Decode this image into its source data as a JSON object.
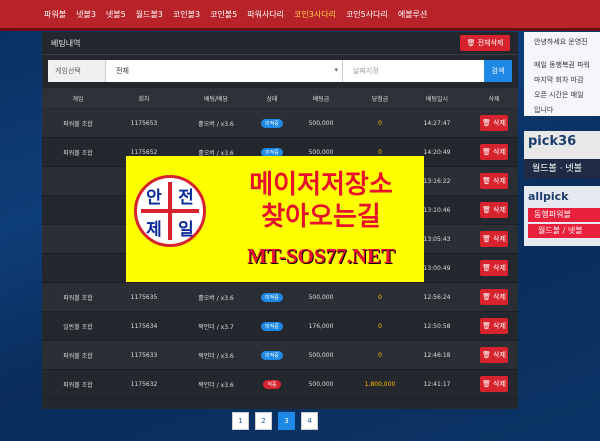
{
  "nav": {
    "items": [
      "파워볼",
      "넷볼3",
      "넷볼5",
      "월드볼3",
      "코인볼3",
      "코인볼5",
      "파워사다리",
      "코인3사다리",
      "코인5사다리",
      "에볼루션"
    ],
    "active_index": 7
  },
  "panel": {
    "title": "베팅내역",
    "delete_all_label": "전체삭제"
  },
  "filter": {
    "label": "게임선택",
    "select_value": "전체",
    "date_placeholder": "날짜지정",
    "search_label": "검색"
  },
  "table": {
    "headers": [
      "게임",
      "회차",
      "배팅/배당",
      "상태",
      "배팅금",
      "당첨금",
      "배팅일시",
      "삭제"
    ],
    "rows": [
      {
        "game": "파워볼 조합",
        "round": "1175653",
        "pick": "홀오버 / x3.6",
        "status": "미적중",
        "bet": "500,000",
        "win": "0",
        "time": "14:27:47",
        "del": "삭제"
      },
      {
        "game": "파워볼 조합",
        "round": "1175652",
        "pick": "홀오버 / x3.6",
        "status": "미적중",
        "bet": "500,000",
        "win": "0",
        "time": "14:20:49",
        "del": "삭제"
      },
      {
        "game": "",
        "round": "",
        "pick": "",
        "status": "",
        "bet": "",
        "win": "",
        "time": "13:16:22",
        "del": "삭제"
      },
      {
        "game": "",
        "round": "",
        "pick": "",
        "status": "",
        "bet": "",
        "win": "",
        "time": "13:10:46",
        "del": "삭제"
      },
      {
        "game": "",
        "round": "",
        "pick": "",
        "status": "",
        "bet": "",
        "win": "",
        "time": "13:05:43",
        "del": "삭제"
      },
      {
        "game": "",
        "round": "",
        "pick": "",
        "status": "",
        "bet": "",
        "win": "",
        "time": "13:00:49",
        "del": "삭제"
      },
      {
        "game": "파워볼 조합",
        "round": "1175635",
        "pick": "홀오버 / x3.6",
        "status": "미적중",
        "bet": "500,000",
        "win": "0",
        "time": "12:56:24",
        "del": "삭제"
      },
      {
        "game": "일반볼 조합",
        "round": "1175634",
        "pick": "짝언더 / x3.7",
        "status": "미적중",
        "bet": "176,000",
        "win": "0",
        "time": "12:50:58",
        "del": "삭제"
      },
      {
        "game": "파워볼 조합",
        "round": "1175633",
        "pick": "짝언더 / x3.6",
        "status": "미적중",
        "bet": "500,000",
        "win": "0",
        "time": "12:46:18",
        "del": "삭제"
      },
      {
        "game": "파워볼 조합",
        "round": "1175632",
        "pick": "짝언더 / x3.6",
        "status": "적중",
        "bet": "500,000",
        "win": "1,800,000",
        "time": "12:41:17",
        "del": "삭제"
      }
    ]
  },
  "pagination": {
    "pages": [
      "1",
      "2",
      "3",
      "4"
    ],
    "current": "3"
  },
  "sidebar": {
    "lines": [
      "안녕하세요 운영진",
      "",
      "매일 동행복권 파워",
      "마지막 회차 마감",
      "오픈 시간은 매일",
      "입니다"
    ]
  },
  "banners": {
    "pick365": {
      "logo": "pick36",
      "sub": "월드볼 · 넷볼"
    },
    "allpick": {
      "logo": "allpick",
      "line1": "동행파워볼",
      "line2": "월드볼 / 넷볼"
    }
  },
  "ad": {
    "seal_chars": [
      "안",
      "전",
      "제",
      "일"
    ],
    "line1": "메이저저장소",
    "line2": "찾아오는길",
    "url": "MT-SOS77.NET"
  },
  "colors": {
    "nav_bg": "#b8232a",
    "panel_bg": "#24272e",
    "accent_blue": "#1e88e5",
    "accent_red": "#d7232d",
    "ad_bg": "#ffff00",
    "ad_text": "#e8112d"
  }
}
